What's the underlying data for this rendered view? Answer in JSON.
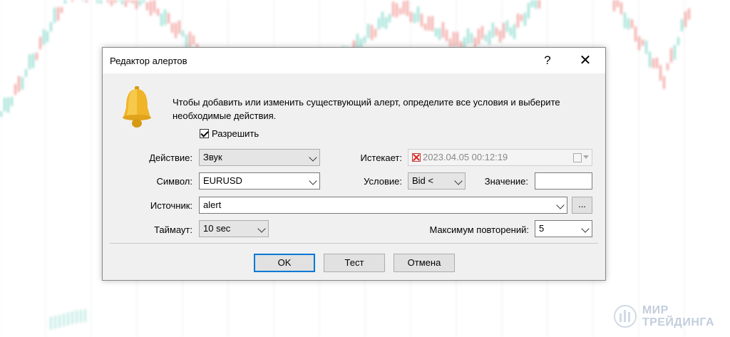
{
  "window": {
    "title": "Редактор алертов",
    "help": "?",
    "close": "✕"
  },
  "info_text": "Чтобы добавить или изменить существующий алерт, определите все условия и выберите необходимые действия.",
  "enable": {
    "label": "Разрешить",
    "checked": true
  },
  "fields": {
    "action": {
      "label": "Действие:",
      "value": "Звук"
    },
    "expires": {
      "label": "Истекает:",
      "value": "2023.04.05 00:12:19",
      "enabled": false
    },
    "symbol": {
      "label": "Символ:",
      "value": "EURUSD"
    },
    "condition": {
      "label": "Условие:",
      "value": "Bid <"
    },
    "value": {
      "label": "Значение:",
      "value": ""
    },
    "source": {
      "label": "Источник:",
      "value": "alert",
      "browse": "..."
    },
    "timeout": {
      "label": "Таймаут:",
      "value": "10 sec"
    },
    "max_repeats": {
      "label": "Максимум повторений:",
      "value": "5"
    }
  },
  "buttons": {
    "ok": "OK",
    "test": "Тест",
    "cancel": "Отмена"
  },
  "watermark": {
    "line1": "МИР",
    "line2": "ТРЕЙДИНГА"
  },
  "colors": {
    "accent": "#0078d7",
    "bell": "#f0b429",
    "bull": "#4fc9b5",
    "bear": "#e9645f"
  }
}
